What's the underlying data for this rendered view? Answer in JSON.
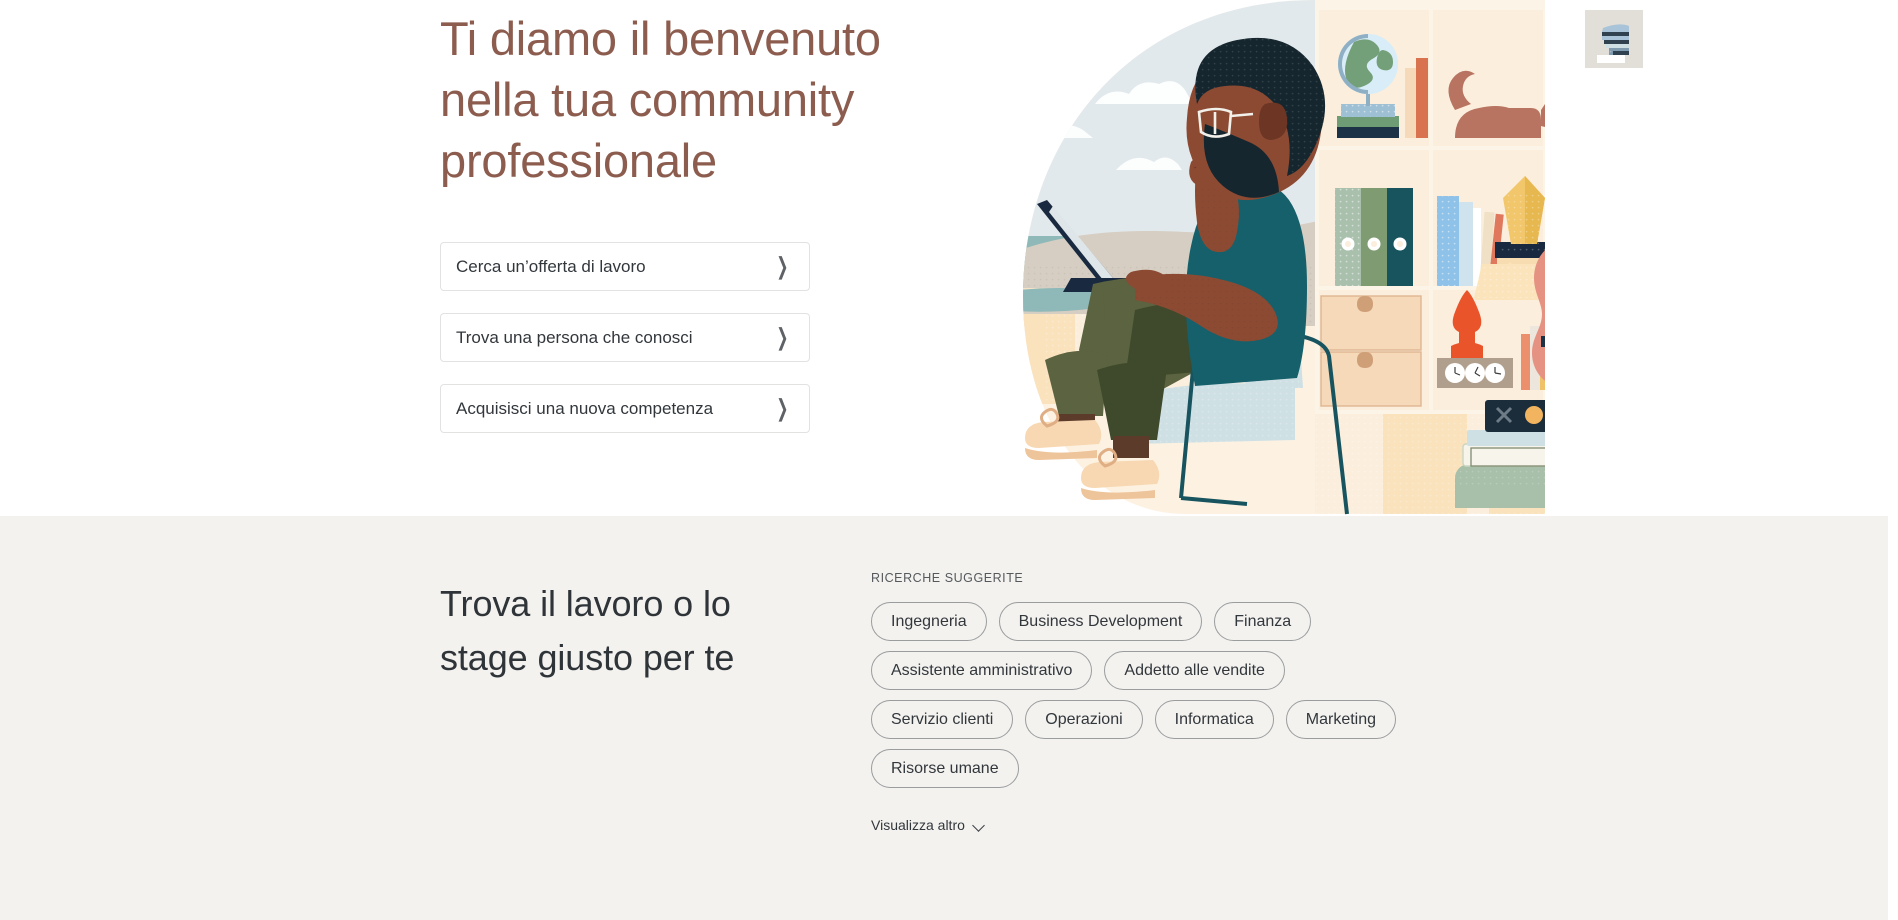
{
  "hero": {
    "title": "Ti diamo il benvenuto nella tua community professionale",
    "title_color": "#8c5c4e",
    "cta": [
      {
        "label": "Cerca un’offerta di lavoro",
        "icon": "chevron-right-icon",
        "chevron": "❯"
      },
      {
        "label": "Trova una persona che conosci",
        "icon": "chevron-right-icon",
        "chevron": "❯"
      },
      {
        "label": "Acquisisci una nuova competenza",
        "icon": "chevron-right-icon",
        "chevron": "❯"
      }
    ],
    "illustration": {
      "name": "person-reading-laptop-bookshelf-illustration",
      "description": "Man with glasses and beard sitting in an armchair with a laptop in front of a bookshelf",
      "palette": {
        "backdrop": "#dfe6e9",
        "sky": "#e3eaec",
        "sand": "#d6cec2",
        "sea": "#8fb8b8",
        "shelf_wood": "#fbeedd",
        "shelf_panel": "#fdf4e8",
        "skin": "#8c4a33",
        "hair": "#15262e",
        "shirt": "#15606b",
        "pants": "#5b6340",
        "pants_shadow": "#3f4a2c",
        "shoe": "#f7d8b2",
        "chair": "#cfe0e4",
        "chair_frame": "#17545f",
        "laptop": "#19293f",
        "guitar": "#e59282",
        "guitar_neck": "#b96a57",
        "cat": "#b87361",
        "lamp_shade": "#fbe4bb",
        "lamp_base": "#e9542b",
        "ottoman": "#a8bfa9",
        "frame_bg": "#e2dfd9",
        "frame_art": "#a9c3d8",
        "frame_art_dark": "#30424f"
      }
    }
  },
  "lower": {
    "title": "Trova il lavoro o lo stage giusto per te",
    "suggested_label": "RICERCHE SUGGERITE",
    "chips": [
      "Ingegneria",
      "Business Development",
      "Finanza",
      "Assistente amministrativo",
      "Addetto alle vendite",
      "Servizio clienti",
      "Operazioni",
      "Informatica",
      "Marketing",
      "Risorse umane"
    ],
    "show_more": "Visualizza altro",
    "show_more_icon": "chevron-down-icon",
    "background": "#f3f2ef"
  }
}
